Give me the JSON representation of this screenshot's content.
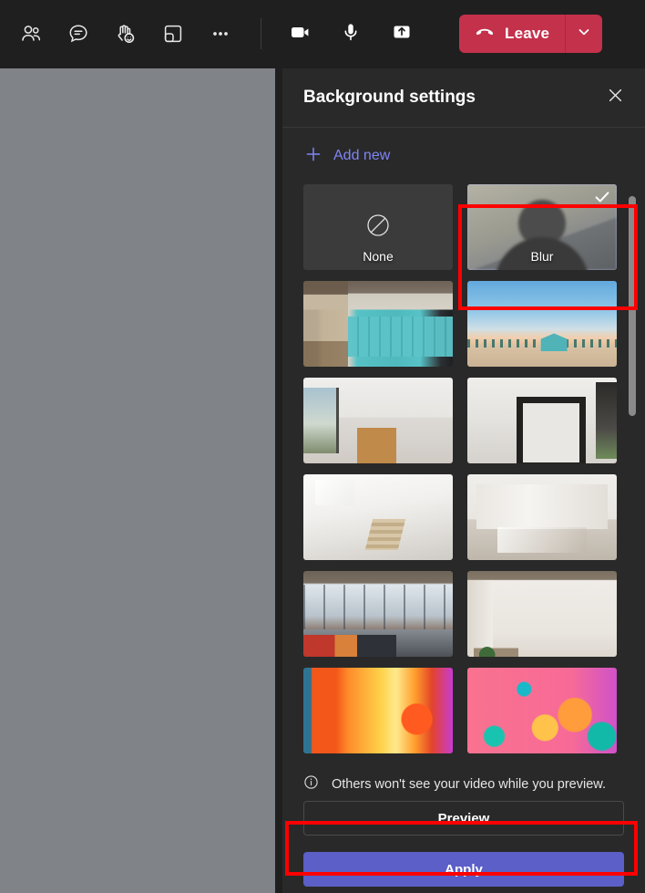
{
  "callbar": {
    "left_buttons": [
      {
        "name": "people-icon",
        "label": "People"
      },
      {
        "name": "chat-icon",
        "label": "Chat"
      },
      {
        "name": "raise-hand-reactions-icon",
        "label": "Reactions"
      },
      {
        "name": "rooms-icon",
        "label": "Breakout rooms"
      },
      {
        "name": "more-options-icon",
        "label": "More actions"
      }
    ],
    "right_buttons": [
      {
        "name": "camera-icon",
        "label": "Camera"
      },
      {
        "name": "microphone-icon",
        "label": "Mic"
      },
      {
        "name": "share-content-icon",
        "label": "Share content"
      }
    ],
    "leave_label": "Leave",
    "leave_chevron": "chevron-down-icon",
    "leave_color": "#c4314b"
  },
  "panel": {
    "title": "Background settings",
    "close_icon": "close-icon",
    "add_new": {
      "label": "Add new",
      "icon": "plus-icon",
      "color": "#7f85f5"
    },
    "backgrounds": [
      {
        "label": "None",
        "art": "none-thumb",
        "selected": false,
        "checked": false
      },
      {
        "label": "Blur",
        "art": "blur",
        "selected": true,
        "checked": true
      },
      {
        "label": "",
        "art": "a-lockers",
        "selected": false,
        "checked": false
      },
      {
        "label": "",
        "art": "a-beach",
        "selected": false,
        "checked": false
      },
      {
        "label": "",
        "art": "a-room1",
        "selected": false,
        "checked": false
      },
      {
        "label": "",
        "art": "a-room2",
        "selected": false,
        "checked": false
      },
      {
        "label": "",
        "art": "a-atrium",
        "selected": false,
        "checked": false
      },
      {
        "label": "",
        "art": "a-gallery",
        "selected": false,
        "checked": false
      },
      {
        "label": "",
        "art": "a-loft",
        "selected": false,
        "checked": false
      },
      {
        "label": "",
        "art": "a-plain",
        "selected": false,
        "checked": false
      },
      {
        "label": "",
        "art": "a-orange",
        "selected": false,
        "checked": false
      },
      {
        "label": "",
        "art": "a-pink",
        "selected": false,
        "checked": false
      }
    ],
    "scrollbar": {
      "thumb_top_pct": 2,
      "thumb_height_pct": 38
    },
    "footer": {
      "info_icon": "info-icon",
      "info_text": "Others won't see your video while you preview.",
      "preview_label": "Preview",
      "apply_label": "Apply",
      "apply_color": "#5b5fc7"
    }
  },
  "annotations": {
    "highlight_color": "#ff0000",
    "boxes": [
      {
        "name": "blur-option-highlight",
        "target": "Blur"
      },
      {
        "name": "apply-button-highlight",
        "target": "Apply"
      }
    ]
  }
}
